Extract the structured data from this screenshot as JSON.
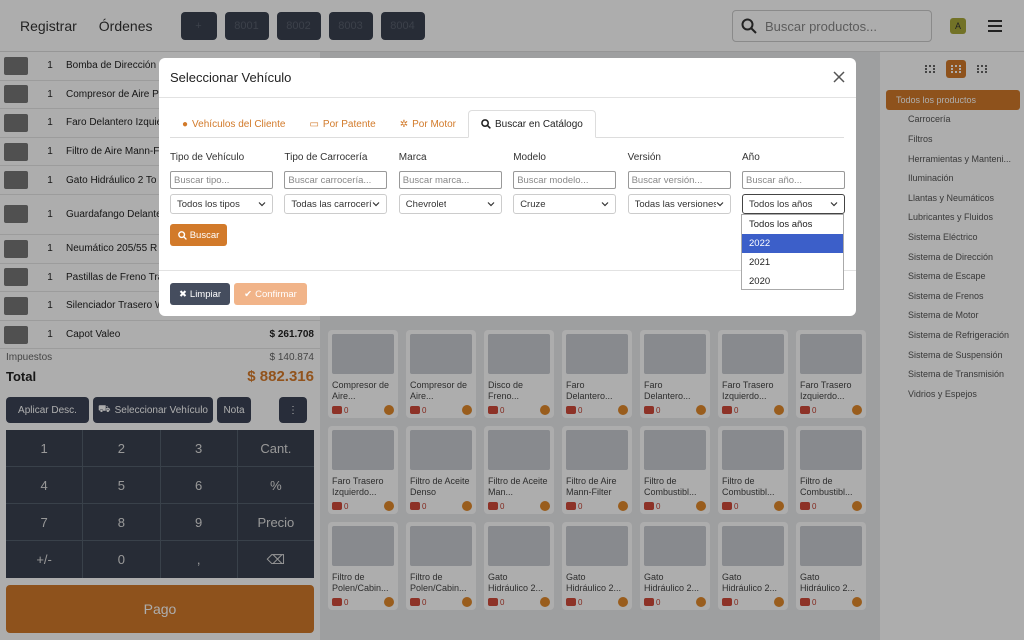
{
  "topbar": {
    "nav": [
      "Registrar",
      "Órdenes"
    ],
    "tickets": [
      "8001",
      "8002",
      "8003",
      "8004"
    ],
    "search_placeholder": "Buscar productos...",
    "avatar_initial": "A"
  },
  "cart": {
    "items": [
      {
        "qty": "1",
        "name": "Bomba de Dirección",
        "price": ""
      },
      {
        "qty": "1",
        "name": "Compresor de Aire P",
        "price": ""
      },
      {
        "qty": "1",
        "name": "Faro Delantero Izquie",
        "price": ""
      },
      {
        "qty": "1",
        "name": "Filtro de Aire Mann-F",
        "price": ""
      },
      {
        "qty": "1",
        "name": "Gato Hidráulico 2 To",
        "price": ""
      },
      {
        "qty": "1",
        "name": "Guardafango Delante Marelli",
        "price": ""
      },
      {
        "qty": "1",
        "name": "Neumático 205/55 R",
        "price": ""
      },
      {
        "qty": "1",
        "name": "Pastillas de Freno Tra",
        "price": ""
      },
      {
        "qty": "1",
        "name": "Silenciador Trasero W",
        "price": ""
      },
      {
        "qty": "1",
        "name": "Capot Valeo",
        "price": "$ 261.708"
      }
    ],
    "tax_label": "Impuestos",
    "tax_value": "$ 140.874",
    "total_label": "Total",
    "total_value": "$ 882.316"
  },
  "actions": {
    "discount": "Aplicar Desc.",
    "select_vehicle": "Seleccionar Vehículo",
    "note": "Nota",
    "more": "⋮"
  },
  "keypad": [
    "1",
    "2",
    "3",
    "Cant.",
    "4",
    "5",
    "6",
    "%",
    "7",
    "8",
    "9",
    "Precio",
    "+/-",
    "0",
    ",",
    "⌫"
  ],
  "pay_label": "Pago",
  "products": [
    {
      "name": "Compresor de Aire...",
      "count": "0"
    },
    {
      "name": "Compresor de Aire...",
      "count": "0"
    },
    {
      "name": "Disco de Freno...",
      "count": "0"
    },
    {
      "name": "Faro Delantero...",
      "count": "0"
    },
    {
      "name": "Faro Delantero...",
      "count": "0"
    },
    {
      "name": "Faro Trasero Izquierdo...",
      "count": "0"
    },
    {
      "name": "Faro Trasero Izquierdo...",
      "count": "0"
    },
    {
      "name": "Faro Trasero Izquierdo...",
      "count": "0"
    },
    {
      "name": "Filtro de Aceite Denso",
      "count": "0"
    },
    {
      "name": "Filtro de Aceite Man...",
      "count": "0"
    },
    {
      "name": "Filtro de Aire Mann-Filter",
      "count": "0"
    },
    {
      "name": "Filtro de Combustibl...",
      "count": "0"
    },
    {
      "name": "Filtro de Combustibl...",
      "count": "0"
    },
    {
      "name": "Filtro de Combustibl...",
      "count": "0"
    },
    {
      "name": "Filtro de Polen/Cabin...",
      "count": "0"
    },
    {
      "name": "Filtro de Polen/Cabin...",
      "count": "0"
    },
    {
      "name": "Gato Hidráulico 2...",
      "count": "0"
    },
    {
      "name": "Gato Hidráulico 2...",
      "count": "0"
    },
    {
      "name": "Gato Hidráulico 2...",
      "count": "0"
    },
    {
      "name": "Gato Hidráulico 2...",
      "count": "0"
    },
    {
      "name": "Gato Hidráulico 2...",
      "count": "0"
    }
  ],
  "categories": [
    "Todos los productos",
    "Carrocería",
    "Filtros",
    "Herramientas y Manteni...",
    "Iluminación",
    "Llantas y Neumáticos",
    "Lubricantes y Fluidos",
    "Sistema Eléctrico",
    "Sistema de Dirección",
    "Sistema de Escape",
    "Sistema de Frenos",
    "Sistema de Motor",
    "Sistema de Refrigeración",
    "Sistema de Suspensión",
    "Sistema de Transmisión",
    "Vidrios y Espejos"
  ],
  "modal": {
    "title": "Seleccionar Vehículo",
    "tabs": [
      "Vehículos del Cliente",
      "Por Patente",
      "Por Motor",
      "Buscar en Catálogo"
    ],
    "fields": [
      {
        "label": "Tipo de Vehículo",
        "placeholder": "Buscar tipo...",
        "selected": "Todos los tipos"
      },
      {
        "label": "Tipo de Carrocería",
        "placeholder": "Buscar carrocería...",
        "selected": "Todas las carrocerías"
      },
      {
        "label": "Marca",
        "placeholder": "Buscar marca...",
        "selected": "Chevrolet"
      },
      {
        "label": "Modelo",
        "placeholder": "Buscar modelo...",
        "selected": "Cruze"
      },
      {
        "label": "Versión",
        "placeholder": "Buscar versión...",
        "selected": "Todas las versiones"
      },
      {
        "label": "Año",
        "placeholder": "Buscar año...",
        "selected": "Todos los años"
      }
    ],
    "search_button": "Buscar",
    "clear_button": "Limpiar",
    "confirm_button": "Confirmar",
    "year_options": [
      "Todos los años",
      "2022",
      "2021",
      "2020"
    ],
    "highlighted_option": "2022"
  },
  "colors": {
    "accent": "#d27a2a",
    "dark": "#3b4356",
    "highlight": "#3c5fc9"
  }
}
